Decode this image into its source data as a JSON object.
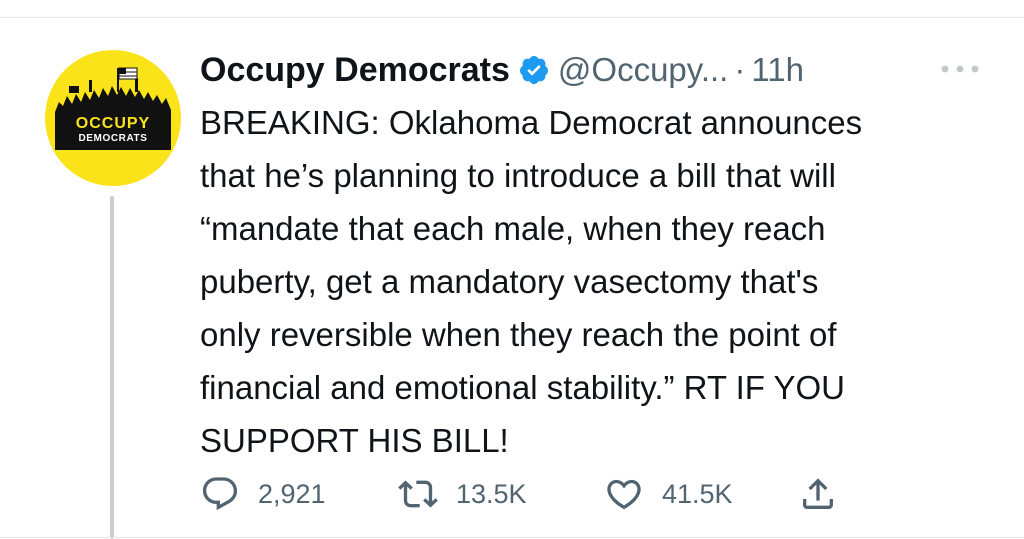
{
  "tweet": {
    "author": {
      "display_name": "Occupy Democrats",
      "handle": "@Occupy...",
      "verified": true,
      "avatar": {
        "bg_color": "#fbe319",
        "text_top": "OCCUPY",
        "text_bottom": "DEMOCRATS"
      }
    },
    "separator": "·",
    "time": "11h",
    "more_icon": "more-horizontal-icon",
    "text_lines": [
      "BREAKING: Oklahoma Democrat announces",
      "that he’s planning to introduce a bill that will",
      "“mandate that each male, when they reach",
      "puberty, get a mandatory vasectomy that's",
      "only reversible when they reach the point of",
      "financial and emotional stability.” RT IF YOU",
      "SUPPORT HIS BILL!"
    ],
    "actions": {
      "reply": {
        "icon": "reply-icon",
        "count": "2,921"
      },
      "retweet": {
        "icon": "retweet-icon",
        "count": "13.5K"
      },
      "like": {
        "icon": "heart-icon",
        "count": "41.5K"
      },
      "share": {
        "icon": "share-icon"
      }
    }
  },
  "colors": {
    "text": "#0f1419",
    "secondary": "#536471",
    "verified": "#1d9bf0",
    "avatar_yellow": "#fbe319"
  }
}
